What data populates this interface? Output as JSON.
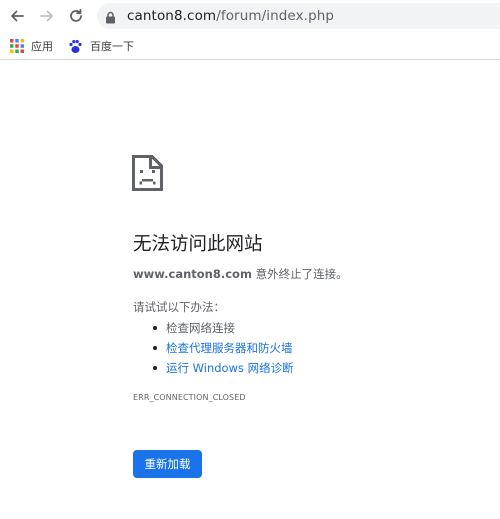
{
  "address_bar": {
    "url_host": "canton8.com",
    "url_path": "/forum/index.php"
  },
  "bookmarks": [
    {
      "label": "应用",
      "icon": "apps-grid-icon"
    },
    {
      "label": "百度一下",
      "icon": "baidu-paw-icon"
    }
  ],
  "error_page": {
    "title": "无法访问此网站",
    "host": "www.canton8.com",
    "description_suffix": " 意外终止了连接。",
    "try_label": "请试试以下办法：",
    "suggestions": [
      {
        "label": "检查网络连接",
        "is_link": false
      },
      {
        "label": "检查代理服务器和防火墙",
        "is_link": true
      },
      {
        "label": "运行 Windows 网络诊断",
        "is_link": true
      }
    ],
    "error_code": "ERR_CONNECTION_CLOSED",
    "reload_label": "重新加载"
  },
  "colors": {
    "link": "#1a73e8",
    "button": "#1a73e8",
    "text": "#202124",
    "secondary_text": "#5f6368"
  }
}
